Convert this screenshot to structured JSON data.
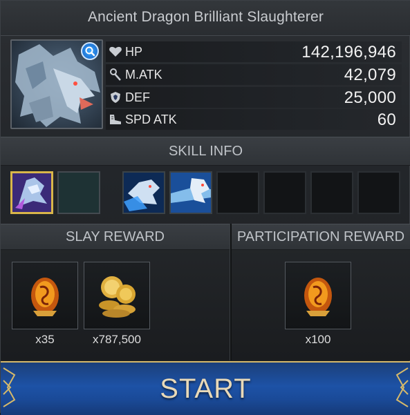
{
  "boss": {
    "name": "Ancient Dragon Brilliant Slaughterer",
    "stats": [
      {
        "icon": "heart-icon",
        "label": "HP",
        "value": "142,196,946"
      },
      {
        "icon": "staff-icon",
        "label": "M.ATK",
        "value": "42,079"
      },
      {
        "icon": "shield-icon",
        "label": "DEF",
        "value": "25,000"
      },
      {
        "icon": "boot-icon",
        "label": "SPD ATK",
        "value": "60"
      }
    ]
  },
  "skills": {
    "header": "SKILL INFO",
    "slots": [
      {
        "state": "selected",
        "icon": "dragon-skill-icon"
      },
      {
        "state": "blank",
        "icon": ""
      },
      {
        "state": "filled",
        "icon": "dragon-breath-skill-icon"
      },
      {
        "state": "filled",
        "icon": "dragon-roar-skill-icon"
      },
      {
        "state": "empty",
        "icon": ""
      },
      {
        "state": "empty",
        "icon": ""
      },
      {
        "state": "empty",
        "icon": ""
      },
      {
        "state": "empty",
        "icon": ""
      }
    ]
  },
  "slay_reward": {
    "header": "SLAY REWARD",
    "items": [
      {
        "icon": "fire-egg-icon",
        "qty": "x35"
      },
      {
        "icon": "gold-coins-icon",
        "qty": "x787,500"
      }
    ]
  },
  "participation_reward": {
    "header": "PARTICIPATION REWARD",
    "items": [
      {
        "icon": "fire-egg-icon",
        "qty": "x100"
      }
    ]
  },
  "start_label": "START",
  "colors": {
    "accent_gold": "#d9b64a",
    "start_blue": "#1d52a6",
    "panel": "#2c2f33"
  }
}
